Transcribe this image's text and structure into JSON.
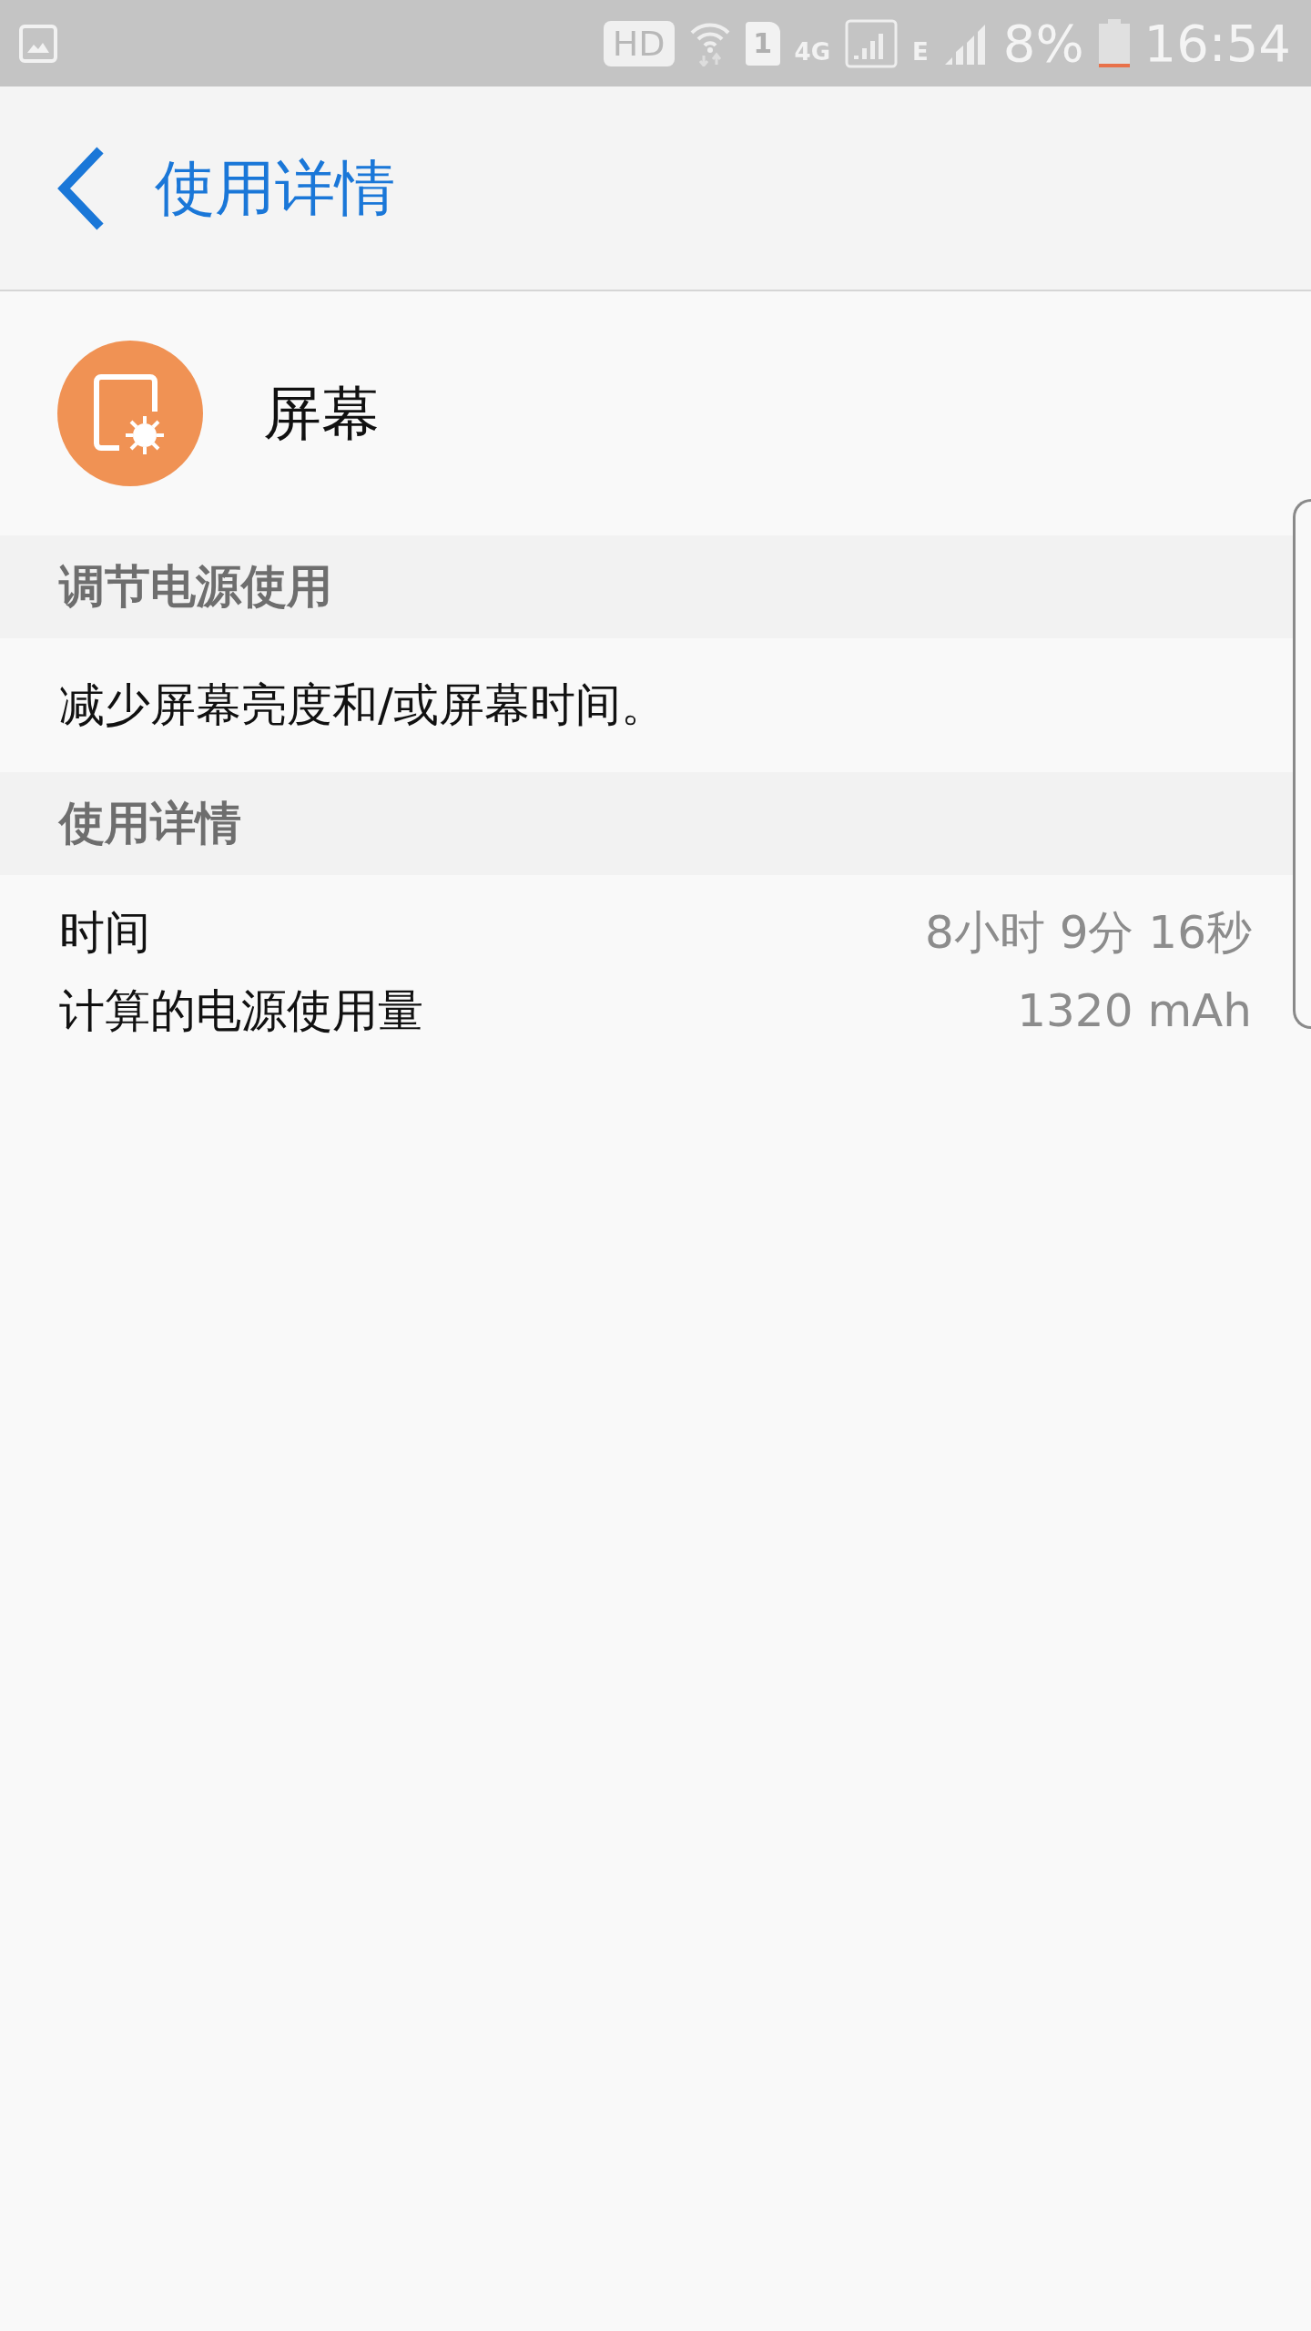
{
  "status_bar": {
    "hd": "HD",
    "sim": "1",
    "network": "4G",
    "network_2": "E",
    "battery": "8%",
    "time": "16:54"
  },
  "header": {
    "title": "使用详情"
  },
  "app": {
    "name": "屏幕"
  },
  "sections": [
    {
      "title": "调节电源使用",
      "kind": "text",
      "text": "减少屏幕亮度和/或屏幕时间。"
    },
    {
      "title": "使用详情",
      "kind": "details",
      "rows": [
        {
          "label": "时间",
          "value": "8小时 9分 16秒"
        },
        {
          "label": "计算的电源使用量",
          "value": "1320 mAh"
        }
      ]
    }
  ]
}
